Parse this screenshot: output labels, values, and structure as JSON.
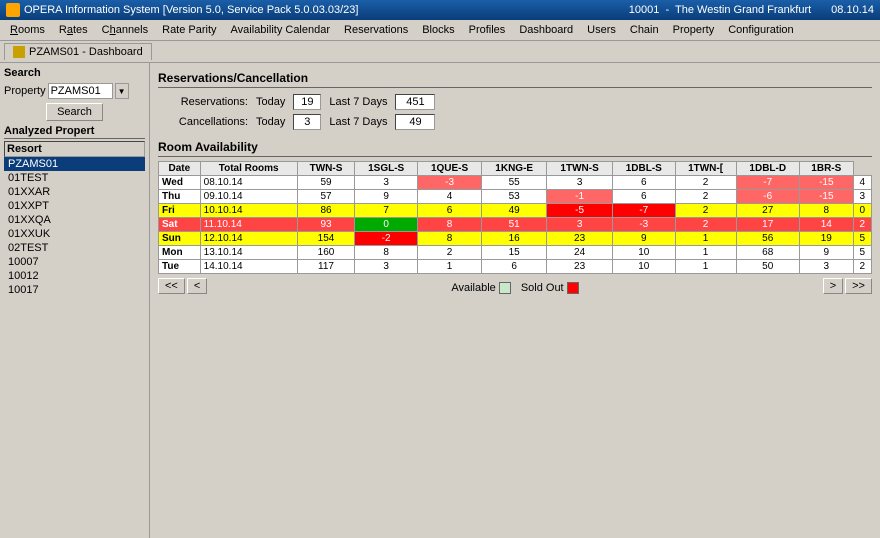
{
  "titleBar": {
    "icon": "opera-icon",
    "title": "OPERA Information System [Version 5.0, Service Pack 5.0.03.03/23]",
    "hotelCode": "10001",
    "hotelName": "The Westin Grand Frankfurt",
    "date": "08.10.14"
  },
  "menuBar": {
    "items": [
      "Rooms",
      "Rates",
      "Channels",
      "Rate Parity",
      "Availability Calendar",
      "Reservations",
      "Blocks",
      "Profiles",
      "Dashboard",
      "Users",
      "Chain",
      "Property",
      "Configuration"
    ]
  },
  "tabBar": {
    "tabs": [
      "PZAMS01 - Dashboard"
    ]
  },
  "leftPanel": {
    "searchLabel": "Search",
    "propertyLabel": "Property",
    "propertyValue": "PZAMS01",
    "searchButton": "Search",
    "analyzedTitle": "Analyzed Propert",
    "resortHeader": "Resort",
    "properties": [
      "PZAMS01",
      "01TEST",
      "01XXAR",
      "01XXPT",
      "01XXQA",
      "01XXUK",
      "02TEST",
      "10007",
      "10012",
      "10017"
    ]
  },
  "reservations": {
    "sectionTitle": "Reservations/Cancellation",
    "reservationsLabel": "Reservations:",
    "todayLabel": "Today",
    "todayReservations": "19",
    "last7DaysLabel": "Last 7 Days",
    "last7Reservations": "451",
    "cancellationsLabel": "Cancellations:",
    "todayCancellations": "3",
    "last7Cancellations": "49"
  },
  "roomAvailability": {
    "sectionTitle": "Room Availability",
    "columns": [
      "Date",
      "Total Rooms",
      "TWN-S",
      "1SGL-S",
      "1QUE-S",
      "1KNG-E",
      "1TWN-S",
      "1DBL-S",
      "1TWN-[",
      "1DBL-D",
      "1BR-S"
    ],
    "rows": [
      {
        "day": "Wed",
        "date": "08.10.14",
        "total": "59",
        "vals": [
          "3",
          "-3",
          "55",
          "3",
          "6",
          "2",
          "-7",
          "-15",
          "4"
        ],
        "rowStyle": "normal"
      },
      {
        "day": "Thu",
        "date": "09.10.14",
        "total": "57",
        "vals": [
          "9",
          "4",
          "53",
          "-1",
          "6",
          "2",
          "-6",
          "-15",
          "3"
        ],
        "rowStyle": "normal"
      },
      {
        "day": "Fri",
        "date": "10.10.14",
        "total": "86",
        "vals": [
          "7",
          "6",
          "49",
          "-5",
          "-7",
          "2",
          "27",
          "8",
          "0"
        ],
        "rowStyle": "yellow"
      },
      {
        "day": "Sat",
        "date": "11.10.14",
        "total": "93",
        "vals": [
          "0",
          "8",
          "51",
          "3",
          "-3",
          "2",
          "17",
          "14",
          "2"
        ],
        "rowStyle": "red"
      },
      {
        "day": "Sun",
        "date": "12.10.14",
        "total": "154",
        "vals": [
          "-2",
          "8",
          "16",
          "23",
          "9",
          "1",
          "56",
          "19",
          "5"
        ],
        "rowStyle": "yellow"
      },
      {
        "day": "Mon",
        "date": "13.10.14",
        "total": "160",
        "vals": [
          "8",
          "2",
          "15",
          "24",
          "10",
          "1",
          "68",
          "9",
          "5"
        ],
        "rowStyle": "normal"
      },
      {
        "day": "Tue",
        "date": "14.10.14",
        "total": "117",
        "vals": [
          "3",
          "1",
          "6",
          "23",
          "10",
          "1",
          "50",
          "3",
          "2"
        ],
        "rowStyle": "normal"
      }
    ],
    "navButtons": {
      "first": "<<",
      "prev": "<",
      "next": ">",
      "last": ">>"
    },
    "legend": {
      "availableLabel": "Available",
      "soldOutLabel": "Sold Out"
    }
  }
}
